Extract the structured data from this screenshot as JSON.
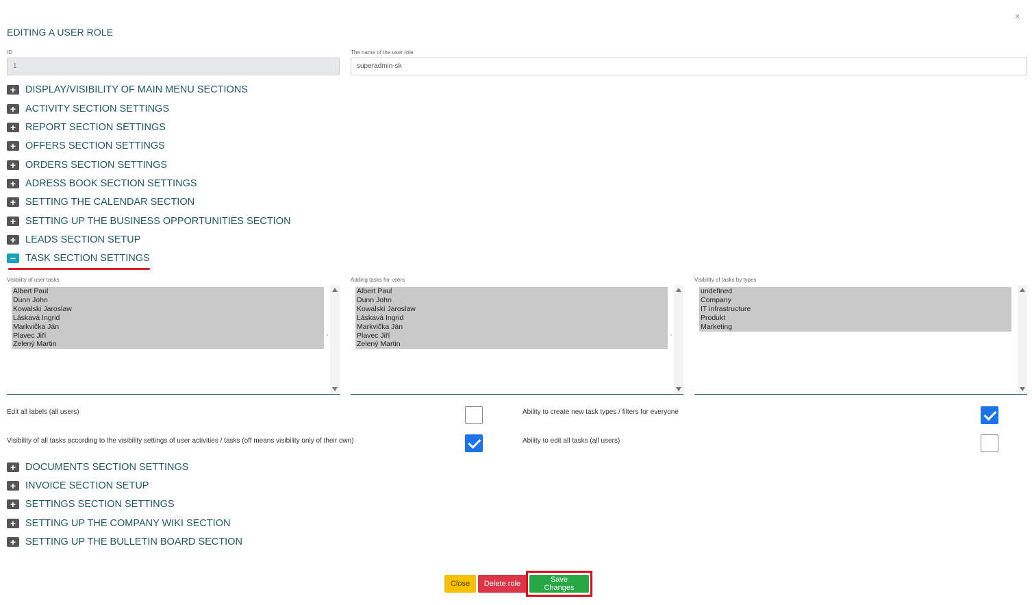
{
  "dialog": {
    "title": "EDITING A USER ROLE",
    "close_symbol": "×"
  },
  "fields": {
    "id_label": "ID",
    "id_value": "1",
    "name_label": "The name of the user role",
    "name_value": "superadmin-sk"
  },
  "sections_before": [
    "DISPLAY/VISIBILITY OF MAIN MENU SECTIONS",
    "ACTIVITY SECTION SETTINGS",
    "REPORT SECTION SETTINGS",
    "OFFERS SECTION SETTINGS",
    "ORDERS SECTION SETTINGS",
    "ADRESS BOOK SECTION SETTINGS",
    "SETTING THE CALENDAR SECTION",
    "SETTING UP THE BUSINESS OPPORTUNITIES SECTION",
    "LEADS SECTION SETUP"
  ],
  "open_section": "TASK SECTION SETTINGS",
  "toggle": {
    "plus": "+",
    "minus": "−"
  },
  "task_lists": [
    {
      "label": "Visibility of user tasks",
      "options": [
        "Albert Paul",
        "Dunn John",
        "Kowalski Jaroslaw",
        "Láskavá Ingrid",
        "Markvička Ján",
        "Plavec Jiří",
        "Zelený Martin"
      ]
    },
    {
      "label": "Adding tasks for users",
      "options": [
        "Albert Paul",
        "Dunn John",
        "Kowalski Jaroslaw",
        "Láskavá Ingrid",
        "Markvička Ján",
        "Plavec Jiří",
        "Zelený Martin"
      ]
    },
    {
      "label": "Visibility of tasks by types",
      "options": [
        "undefined",
        "Company",
        "IT infrastructure",
        "Produkt",
        "Marketing"
      ]
    }
  ],
  "list_tick": "`",
  "task_options": [
    {
      "label": "Edit all labels (all users)",
      "checked": false
    },
    {
      "label": "Ability to create new task types / filters for everyone",
      "checked": true
    },
    {
      "label": "Visibility of all tasks according to the visibility settings of user activities / tasks (off means visibility only of their own)",
      "checked": true
    },
    {
      "label": "Ability to edit all tasks (all users)",
      "checked": false
    }
  ],
  "sections_after": [
    "DOCUMENTS SECTION SETTINGS",
    "INVOICE SECTION SETUP",
    "SETTINGS SECTION SETTINGS",
    "SETTING UP THE COMPANY WIKI SECTION",
    "SETTING UP THE BULLETIN BOARD SECTION"
  ],
  "buttons": {
    "close": "Close",
    "delete": "Delete role",
    "save": "Save Changes"
  },
  "colors": {
    "heading": "#1e5a63",
    "highlight": "#e30b17",
    "checkbox_on": "#1a73e8"
  }
}
